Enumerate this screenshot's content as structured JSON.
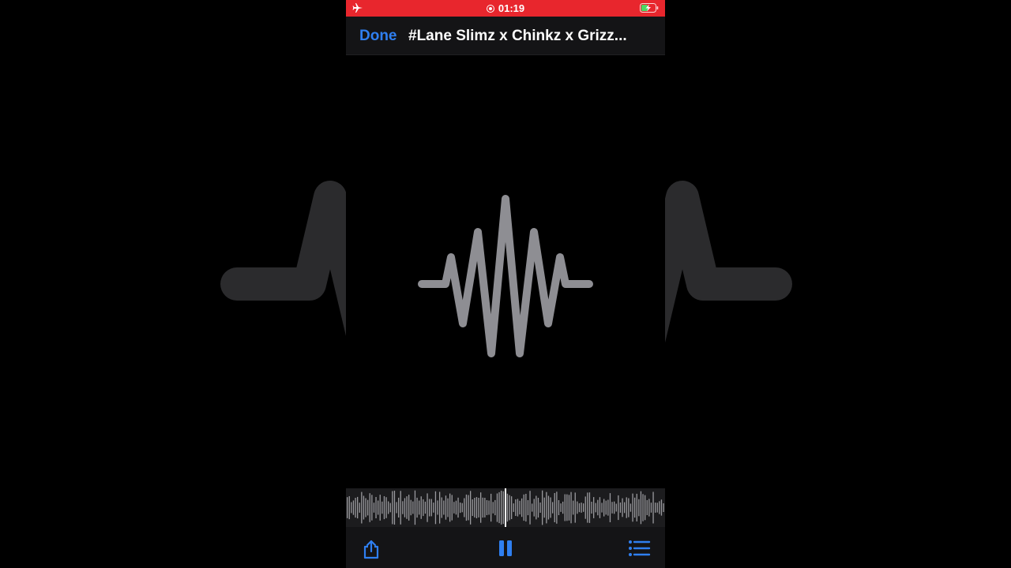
{
  "status_bar": {
    "time": "01:19",
    "color": "#e8262d",
    "icons": [
      "airplane-icon",
      "recording-icon",
      "battery-charging-icon"
    ]
  },
  "nav": {
    "done_label": "Done",
    "title": "#Lane Slimz x Chinkz x Grizz..."
  },
  "artwork": {
    "icon": "waveform-icon",
    "stroke_color": "#8e8e93"
  },
  "playback": {
    "state": "playing",
    "position_fraction": 0.5
  },
  "toolbar": {
    "icons": [
      "share-icon",
      "pause-icon",
      "list-icon"
    ],
    "accent": "#2f7ff0"
  }
}
